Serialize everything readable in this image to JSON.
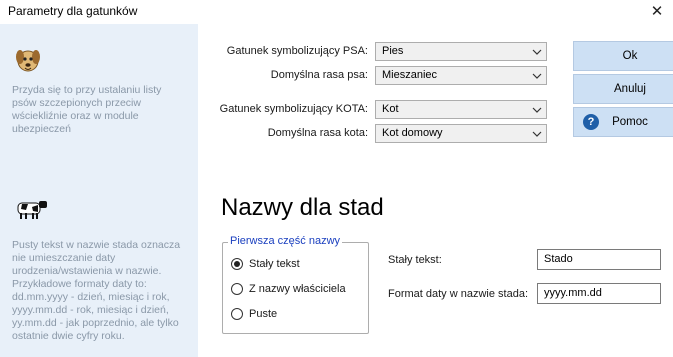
{
  "window": {
    "title": "Parametry dla gatunków"
  },
  "sidebar": {
    "dog_note": "Przyda się to przy ustalaniu listy\npsów szczepionych przeciw\nwściekliźnie oraz w module\nubezpieczeń",
    "herd_note": "Pusty tekst w nazwie stada oznacza\nnie umieszczanie daty\nurodzenia/wstawienia w nazwie.\nPrzykładowe formaty daty to:\n  dd.mm.yyyy - dzień, miesiąc i rok,\n  yyyy.mm.dd - rok, miesiąc i dzień,\n  yy.mm.dd - jak poprzednio, ale tylko\n  ostatnie dwie cyfry roku."
  },
  "species": {
    "dog_label": "Gatunek symbolizujący PSA:",
    "dog_value": "Pies",
    "dog_breed_label": "Domyślna rasa psa:",
    "dog_breed_value": "Mieszaniec",
    "cat_label": "Gatunek symbolizujący KOTA:",
    "cat_value": "Kot",
    "cat_breed_label": "Domyślna rasa kota:",
    "cat_breed_value": "Kot domowy"
  },
  "buttons": {
    "ok": "Ok",
    "cancel": "Anuluj",
    "help": "Pomoc"
  },
  "herd": {
    "title": "Nazwy dla stad",
    "group_title": "Pierwsza część nazwy",
    "options": [
      "Stały tekst",
      "Z nazwy właściciela",
      "Puste"
    ],
    "selected_option": "Stały tekst",
    "fixed_text_label": "Stały tekst:",
    "fixed_text_value": "Stado",
    "date_format_label": "Format daty w nazwie stada:",
    "date_format_value": "yyyy.mm.dd"
  },
  "icons": {
    "close": "close-icon",
    "dog": "dog-icon",
    "cow": "cow-icon",
    "help": "help-icon",
    "dropdown": "chevron-down-icon"
  },
  "colors": {
    "sidebar_bg": "#e8f0f9",
    "button_bg": "#cde0f4",
    "group_title": "#1a3fbf",
    "note_text": "#8a98a8"
  }
}
